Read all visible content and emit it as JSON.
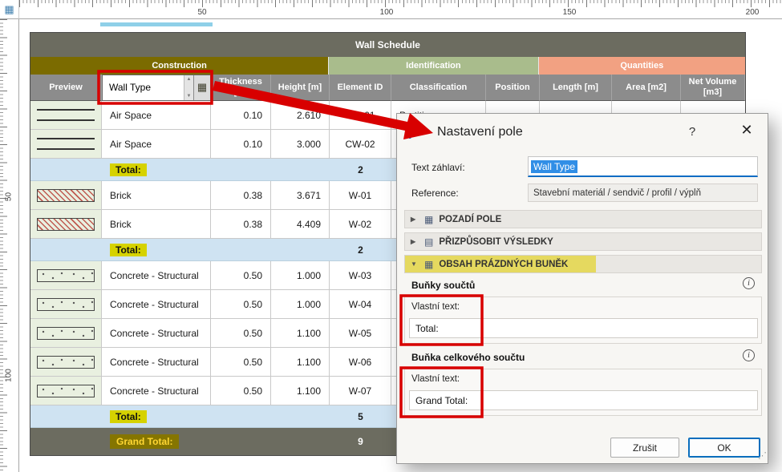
{
  "icons": {
    "corner": "▦",
    "spinner_up": "▲",
    "spinner_down": "▼",
    "field_settings": "▦",
    "help": "?",
    "close": "✕",
    "collapsed": "▶",
    "expanded": "▼",
    "info": "i",
    "section_background_icon": "▦",
    "section_fit_icon": "▤",
    "section_content_icon": "▦",
    "resize_grip": "⋰"
  },
  "rulers": {
    "top_labels": [
      "50",
      "100",
      "150",
      "200"
    ],
    "left_labels": [
      "50",
      "100"
    ]
  },
  "schedule": {
    "title": "Wall Schedule",
    "groups": [
      {
        "label": "Construction",
        "color": "#7b6b00"
      },
      {
        "label": "Identification",
        "color": "#a9bc8c"
      },
      {
        "label": "Quantities",
        "color": "#f2a182"
      }
    ],
    "columns": {
      "preview": "Preview",
      "wall_type": "Wall Type",
      "thickness": "Thickness [m]",
      "height": "Height [m]",
      "element_id": "Element ID",
      "classification": "Classification",
      "position": "Position",
      "length": "Length [m]",
      "area": "Area [m2]",
      "net_volume": "Net Volume [m3]"
    },
    "rows": [
      {
        "pattern": "air",
        "wall_type": "Air Space",
        "thickness": "0.10",
        "height": "2.610",
        "element_id": "CW-01",
        "classification": "Partition"
      },
      {
        "pattern": "air",
        "wall_type": "Air Space",
        "thickness": "0.10",
        "height": "3.000",
        "element_id": "CW-02",
        "classification": ""
      },
      {
        "pattern": "brick",
        "wall_type": "Brick",
        "thickness": "0.38",
        "height": "3.671",
        "element_id": "W-01",
        "classification": ""
      },
      {
        "pattern": "brick",
        "wall_type": "Brick",
        "thickness": "0.38",
        "height": "4.409",
        "element_id": "W-02",
        "classification": ""
      },
      {
        "pattern": "concrete",
        "wall_type": "Concrete - Structural",
        "thickness": "0.50",
        "height": "1.000",
        "element_id": "W-03",
        "classification": ""
      },
      {
        "pattern": "concrete",
        "wall_type": "Concrete - Structural",
        "thickness": "0.50",
        "height": "1.000",
        "element_id": "W-04",
        "classification": ""
      },
      {
        "pattern": "concrete",
        "wall_type": "Concrete - Structural",
        "thickness": "0.50",
        "height": "1.100",
        "element_id": "W-05",
        "classification": ""
      },
      {
        "pattern": "concrete",
        "wall_type": "Concrete - Structural",
        "thickness": "0.50",
        "height": "1.100",
        "element_id": "W-06",
        "classification": ""
      },
      {
        "pattern": "concrete",
        "wall_type": "Concrete - Structural",
        "thickness": "0.50",
        "height": "1.100",
        "element_id": "W-07",
        "classification": ""
      }
    ],
    "totals": [
      {
        "label": "Total:",
        "value": "2"
      },
      {
        "label": "Total:",
        "value": "2"
      },
      {
        "label": "Total:",
        "value": "5"
      }
    ],
    "grand_total": {
      "label": "Grand Total:",
      "value": "9"
    }
  },
  "dialog": {
    "title": "Nastavení pole",
    "header_text": {
      "label": "Text záhlaví:",
      "value": "Wall Type"
    },
    "reference": {
      "label": "Reference:",
      "value": "Stavební materiál / sendvič / profil / výplň"
    },
    "sections": [
      {
        "label": "POZADÍ POLE",
        "expanded": false
      },
      {
        "label": "PŘIZPŮSOBIT VÝSLEDKY",
        "expanded": false
      },
      {
        "label": "OBSAH PRÁZDNÝCH BUNĚK",
        "expanded": true
      }
    ],
    "sum_cells": {
      "title": "Buňky součtů",
      "custom_text_label": "Vlastní text:",
      "custom_text_value": "Total:"
    },
    "grand_total_cell": {
      "title": "Buňka celkového součtu",
      "custom_text_label": "Vlastní text:",
      "custom_text_value": "Grand Total:"
    },
    "buttons": {
      "cancel": "Zrušit",
      "ok": "OK"
    }
  },
  "annotation_color": "#d80000"
}
